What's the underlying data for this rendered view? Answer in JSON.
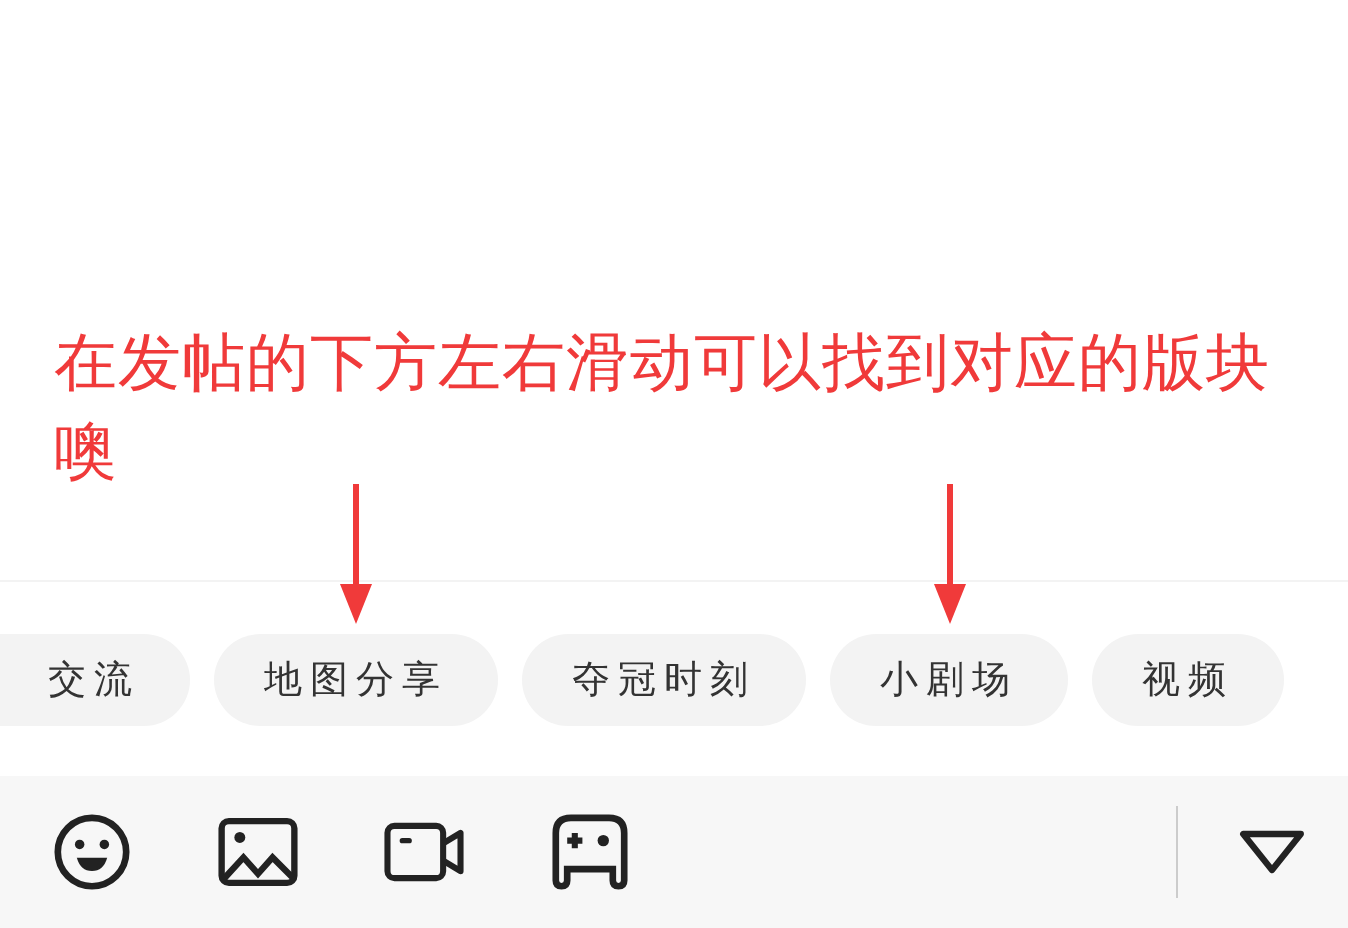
{
  "annotation": {
    "text": "在发帖的下方左右滑动可以找到对应的版块噢"
  },
  "sections": [
    {
      "label": "交流",
      "pointed": false
    },
    {
      "label": "地图分享",
      "pointed": true
    },
    {
      "label": "夺冠时刻",
      "pointed": false
    },
    {
      "label": "小剧场",
      "pointed": true
    },
    {
      "label": "视频",
      "pointed": false
    }
  ],
  "toolbar": {
    "tools": [
      {
        "kind": "emoji"
      },
      {
        "kind": "image"
      },
      {
        "kind": "video"
      },
      {
        "kind": "game"
      }
    ]
  }
}
